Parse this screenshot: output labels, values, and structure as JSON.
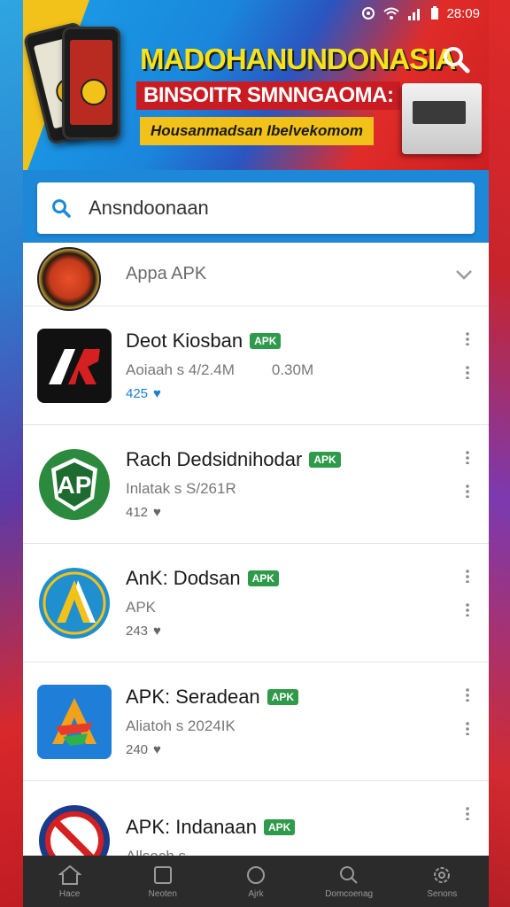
{
  "status_bar": {
    "time": "28:09"
  },
  "banner": {
    "title_main": "MADOHANUNDONASIA",
    "title_sub": "BINSOITR SMNNGAOMA:",
    "tagline": "Housanmadsan Ibelvekomom"
  },
  "search": {
    "value": "Ansndoonaan"
  },
  "section": {
    "label": "Appa APK"
  },
  "apps": [
    {
      "name": "Deot Kiosban",
      "tag": "APK",
      "size": "Aoiaah s  4/2.4M",
      "extra": "0.30M",
      "rating": "425"
    },
    {
      "name": "Rach Dedsidnihodar",
      "tag": "APK",
      "size": "Inlatak s  S/261R",
      "extra": "",
      "rating": "412"
    },
    {
      "name": "AnK: Dodsan",
      "tag": "APK",
      "size": "APK",
      "extra": "",
      "rating": "243"
    },
    {
      "name": "APK: Seradean",
      "tag": "APK",
      "size": "Aliatoh s  2024IK",
      "extra": "",
      "rating": "240"
    },
    {
      "name": "APK: Indanaan",
      "tag": "APK",
      "size": "Allsoch s",
      "extra": "",
      "rating": ""
    }
  ],
  "nav": [
    {
      "label": "Hace",
      "icon": "home-icon"
    },
    {
      "label": "Neoten",
      "icon": "square-icon"
    },
    {
      "label": "Ajrk",
      "icon": "circle-icon"
    },
    {
      "label": "Domcoenag",
      "icon": "search-icon"
    },
    {
      "label": "Senons",
      "icon": "settings-icon"
    }
  ],
  "colors": {
    "accent": "#1e88d8",
    "tag_green": "#2e9a4a",
    "nav_bg": "#2b2b2b"
  }
}
